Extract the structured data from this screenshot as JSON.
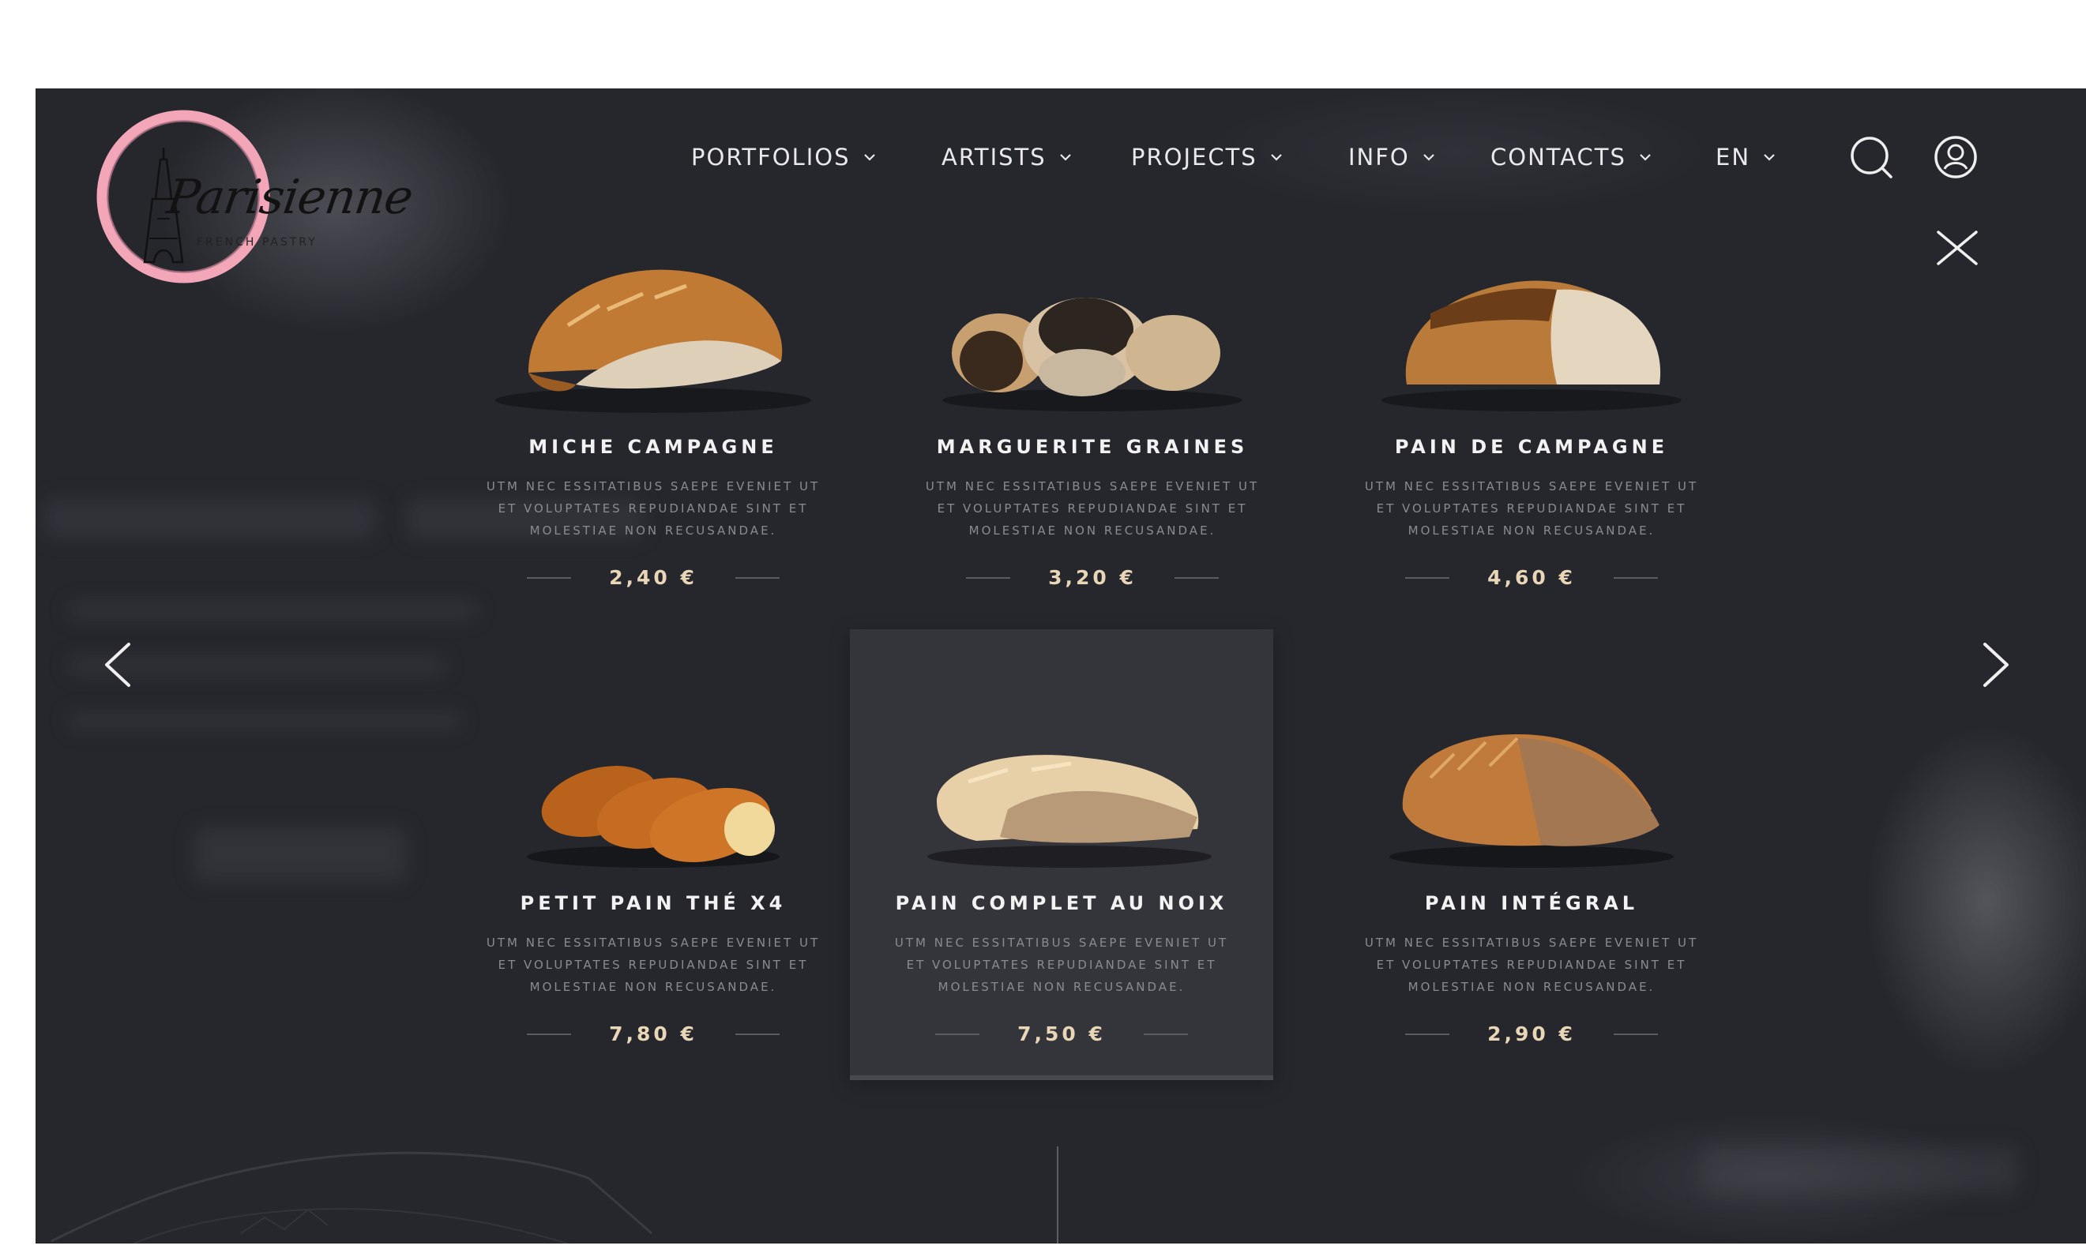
{
  "brand": {
    "name": "Parisienne",
    "tagline": "FRENCH PASTRY",
    "ring_color": "#f2a6b8"
  },
  "nav": {
    "items": [
      {
        "label": "PORTFOLIOS"
      },
      {
        "label": "ARTISTS"
      },
      {
        "label": "PROJECTS"
      },
      {
        "label": "INFO"
      },
      {
        "label": "CONTACTS"
      },
      {
        "label": "EN"
      }
    ],
    "icons": [
      "search-icon",
      "user-icon"
    ]
  },
  "menu": {
    "close_icon": "close-icon",
    "prev_icon": "chevron-left-icon",
    "next_icon": "chevron-right-icon",
    "products": [
      {
        "title": "MICHE CAMPAGNE",
        "desc": "UTM NEC ESSITATIBUS SAEPE EVENIET UT ET VOLUPTATES REPUDIANDAE SINT ET MOLESTIAE NON RECUSANDAE.",
        "price": "2,40 €"
      },
      {
        "title": "MARGUERITE GRAINES",
        "desc": "UTM NEC ESSITATIBUS SAEPE EVENIET UT ET VOLUPTATES REPUDIANDAE SINT ET MOLESTIAE NON RECUSANDAE.",
        "price": "3,20 €"
      },
      {
        "title": "PAIN DE CAMPAGNE",
        "desc": "UTM NEC ESSITATIBUS SAEPE EVENIET UT ET VOLUPTATES REPUDIANDAE SINT ET MOLESTIAE NON RECUSANDAE.",
        "price": "4,60 €"
      },
      {
        "title": "PETIT PAIN THÉ X4",
        "desc": "UTM NEC ESSITATIBUS SAEPE EVENIET UT ET VOLUPTATES REPUDIANDAE SINT ET MOLESTIAE NON RECUSANDAE.",
        "price": "7,80 €"
      },
      {
        "title": "PAIN COMPLET AU NOIX",
        "desc": "UTM NEC ESSITATIBUS SAEPE EVENIET UT ET VOLUPTATES REPUDIANDAE SINT ET MOLESTIAE NON RECUSANDAE.",
        "price": "7,50 €"
      },
      {
        "title": "PAIN INTÉGRAL",
        "desc": "UTM NEC ESSITATIBUS SAEPE EVENIET UT ET VOLUPTATES REPUDIANDAE SINT ET MOLESTIAE NON RECUSANDAE.",
        "price": "2,90 €"
      }
    ]
  },
  "colors": {
    "background": "#2a2b31",
    "active_card": "#34353b",
    "price": "#e8d6b6"
  }
}
